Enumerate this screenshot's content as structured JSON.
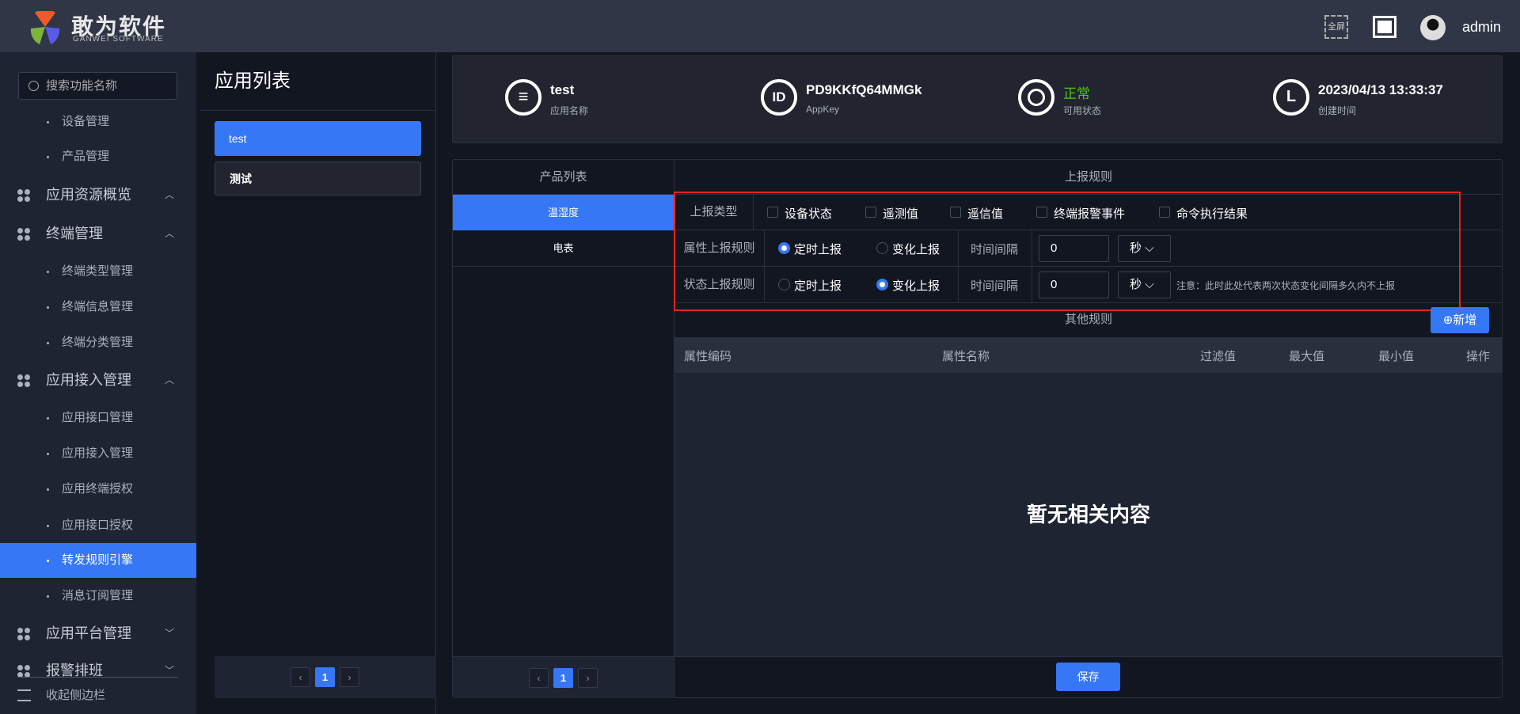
{
  "header": {
    "brand": "敢为软件",
    "brand_sub": "GANWEI SOFTWARE",
    "fullscreen_label": "全屏",
    "user": "admin"
  },
  "sidebar": {
    "search_placeholder": "搜索功能名称",
    "collapse_label": "收起侧边栏",
    "items": [
      {
        "label": "设备管理",
        "type": "sub"
      },
      {
        "label": "产品管理",
        "type": "sub"
      },
      {
        "label": "应用资源概览",
        "type": "group",
        "chevron": "up"
      },
      {
        "label": "终端管理",
        "type": "group",
        "chevron": "up"
      },
      {
        "label": "终端类型管理",
        "type": "sub"
      },
      {
        "label": "终端信息管理",
        "type": "sub"
      },
      {
        "label": "终端分类管理",
        "type": "sub"
      },
      {
        "label": "应用接入管理",
        "type": "group",
        "chevron": "up"
      },
      {
        "label": "应用接口管理",
        "type": "sub"
      },
      {
        "label": "应用接入管理",
        "type": "sub"
      },
      {
        "label": "应用终端授权",
        "type": "sub"
      },
      {
        "label": "应用接口授权",
        "type": "sub"
      },
      {
        "label": "转发规则引擎",
        "type": "sub",
        "active": true
      },
      {
        "label": "消息订阅管理",
        "type": "sub"
      },
      {
        "label": "应用平台管理",
        "type": "group",
        "chevron": "down"
      },
      {
        "label": "报警排班",
        "type": "group",
        "chevron": "down"
      }
    ]
  },
  "app_list": {
    "title": "应用列表",
    "items": [
      "test",
      "测试"
    ],
    "page": "1"
  },
  "info": {
    "name": "test",
    "name_label": "应用名称",
    "appkey": "PD9KKfQ64MMGk",
    "appkey_label": "AppKey",
    "status": "正常",
    "status_label": "可用状态",
    "created": "2023/04/13 13:33:37",
    "created_label": "创建时间",
    "status_color": "#52c41a"
  },
  "products": {
    "header": "产品列表",
    "items": [
      "温湿度",
      "电表"
    ],
    "page": "1"
  },
  "rules": {
    "header": "上报规则",
    "type_label": "上报类型",
    "types": [
      "设备状态",
      "遥测值",
      "遥信值",
      "终端报警事件",
      "命令执行结果"
    ],
    "attr_label": "属性上报规则",
    "state_label": "状态上报规则",
    "timed": "定时上报",
    "change": "变化上报",
    "interval_label": "时间间隔",
    "attr_interval": "0",
    "state_interval": "0",
    "unit": "秒",
    "note": "注意：此时此处代表两次状态变化间隔多久内不上报"
  },
  "other": {
    "header": "其他规则",
    "add_label": "新增",
    "columns": [
      "属性编码",
      "属性名称",
      "过滤值",
      "最大值",
      "最小值",
      "操作"
    ],
    "empty": "暂无相关内容",
    "save_label": "保存"
  }
}
